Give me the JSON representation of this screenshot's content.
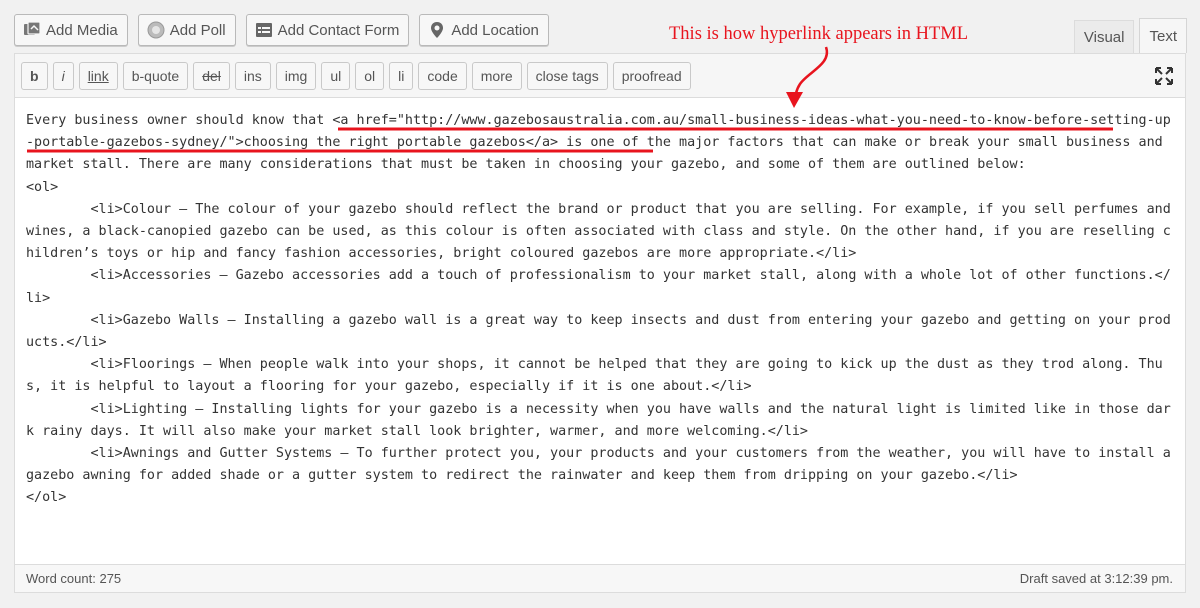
{
  "media_buttons": [
    {
      "label": "Add Media",
      "icon": "media-icon"
    },
    {
      "label": "Add Poll",
      "icon": "poll-icon"
    },
    {
      "label": "Add Contact Form",
      "icon": "form-icon"
    },
    {
      "label": "Add Location",
      "icon": "location-pin-icon"
    }
  ],
  "tabs": {
    "visual": "Visual",
    "text": "Text",
    "active": "text"
  },
  "quicktags": [
    "b",
    "i",
    "link",
    "b-quote",
    "del",
    "ins",
    "img",
    "ul",
    "ol",
    "li",
    "code",
    "more",
    "close tags",
    "proofread"
  ],
  "annotation": {
    "text": "This is how hyperlink appears in HTML",
    "color": "#e8141e"
  },
  "content": {
    "intro_before": "Every business owner should know that ",
    "link_markup": "<a href=\"http://www.gazebosaustralia.com.au/small-business-ideas-what-you-need-to-know-before-setting-up-portable-gazebos-sydney/\">choosing the right portable gazebos</a>",
    "intro_after": " is one of the major factors that can make or break your small business and market stall. There are many considerations that must be taken in choosing your gazebo, and some of them are outlined below:",
    "ol_open": "<ol>",
    "items": [
      "\t<li>Colour – The colour of your gazebo should reflect the brand or product that you are selling. For example, if you sell perfumes and wines, a black-canopied gazebo can be used, as this colour is often associated with class and style. On the other hand, if you are reselling children’s toys or hip and fancy fashion accessories, bright coloured gazebos are more appropriate.</li>",
      "\t<li>Accessories – Gazebo accessories add a touch of professionalism to your market stall, along with a whole lot of other functions.</li>",
      "\t<li>Gazebo Walls – Installing a gazebo wall is a great way to keep insects and dust from entering your gazebo and getting on your products.</li>",
      "\t<li>Floorings – When people walk into your shops, it cannot be helped that they are going to kick up the dust as they trod along. Thus, it is helpful to layout a flooring for your gazebo, especially if it is one about.</li>",
      "\t<li>Lighting – Installing lights for your gazebo is a necessity when you have walls and the natural light is limited like in those dark rainy days. It will also make your market stall look brighter, warmer, and more welcoming.</li>",
      "\t<li>Awnings and Gutter Systems – To further protect you, your products and your customers from the weather, you will have to install a gazebo awning for added shade or a gutter system to redirect the rainwater and keep them from dripping on your gazebo.</li>"
    ],
    "ol_close": "</ol>"
  },
  "status": {
    "word_count": "Word count: 275",
    "draft_saved": "Draft saved at 3:12:39 pm."
  }
}
